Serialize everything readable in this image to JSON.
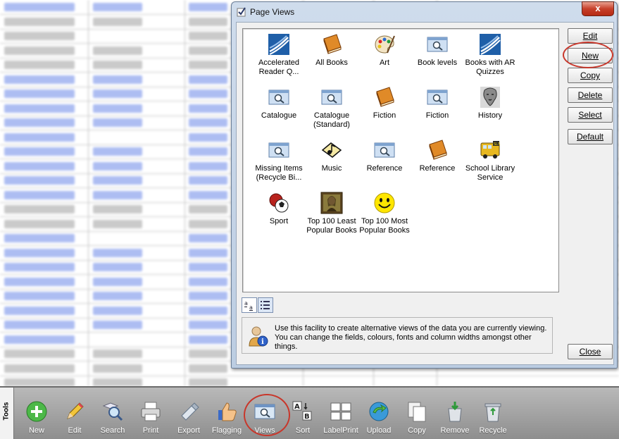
{
  "dialog": {
    "title": "Page Views",
    "close_x": "x",
    "views": [
      {
        "label": "Accelerated Reader Q...",
        "icon": "ar-logo-icon"
      },
      {
        "label": "All Books",
        "icon": "book-icon"
      },
      {
        "label": "Art",
        "icon": "palette-icon"
      },
      {
        "label": "Book levels",
        "icon": "magnifier-window-icon"
      },
      {
        "label": "Books with AR Quizzes",
        "icon": "ar-logo-icon"
      },
      {
        "label": "Catalogue",
        "icon": "magnifier-window-icon"
      },
      {
        "label": "Catalogue (Standard)",
        "icon": "magnifier-window-icon"
      },
      {
        "label": "Fiction",
        "icon": "book-icon"
      },
      {
        "label": "Fiction",
        "icon": "magnifier-window-icon"
      },
      {
        "label": "History",
        "icon": "statue-icon"
      },
      {
        "label": "Missing Items (Recycle Bi...",
        "icon": "magnifier-window-icon"
      },
      {
        "label": "Music",
        "icon": "music-note-icon"
      },
      {
        "label": "Reference",
        "icon": "magnifier-window-icon"
      },
      {
        "label": "Reference",
        "icon": "book-icon"
      },
      {
        "label": "School Library Service",
        "icon": "bus-icon"
      },
      {
        "label": "Sport",
        "icon": "sport-ball-icon"
      },
      {
        "label": "Top 100 Least Popular Books",
        "icon": "mona-lisa-icon"
      },
      {
        "label": "Top 100 Most Popular Books",
        "icon": "smiley-icon"
      }
    ],
    "buttons": {
      "edit": "Edit",
      "new": "New",
      "copy": "Copy",
      "delete": "Delete",
      "select": "Select",
      "default": "Default",
      "close": "Close"
    },
    "info_text": "Use this facility to create alternative views of the data you are currently viewing. You can change the fields, colours, fonts and column widths amongst other things."
  },
  "toolbar": {
    "tab_label": "Tools",
    "tools": [
      {
        "label": "New",
        "icon": "plus-icon"
      },
      {
        "label": "Edit",
        "icon": "pencil-icon"
      },
      {
        "label": "Search",
        "icon": "search-icon"
      },
      {
        "label": "Print",
        "icon": "printer-icon"
      },
      {
        "label": "Export",
        "icon": "usb-drive-icon"
      },
      {
        "label": "Flagging",
        "icon": "thumbs-up-icon"
      },
      {
        "label": "Views",
        "icon": "views-icon"
      },
      {
        "label": "Sort",
        "icon": "sort-icon"
      },
      {
        "label": "LabelPrint",
        "icon": "label-grid-icon"
      },
      {
        "label": "Upload",
        "icon": "upload-icon"
      },
      {
        "label": "Copy",
        "icon": "copy-icon"
      },
      {
        "label": "Remove",
        "icon": "remove-icon"
      },
      {
        "label": "Recycle",
        "icon": "recycle-bin-icon"
      }
    ]
  },
  "colors": {
    "highlight": "#c8372b",
    "link_blue": "#6a86e8",
    "toolbar": "#9c9c9c"
  }
}
